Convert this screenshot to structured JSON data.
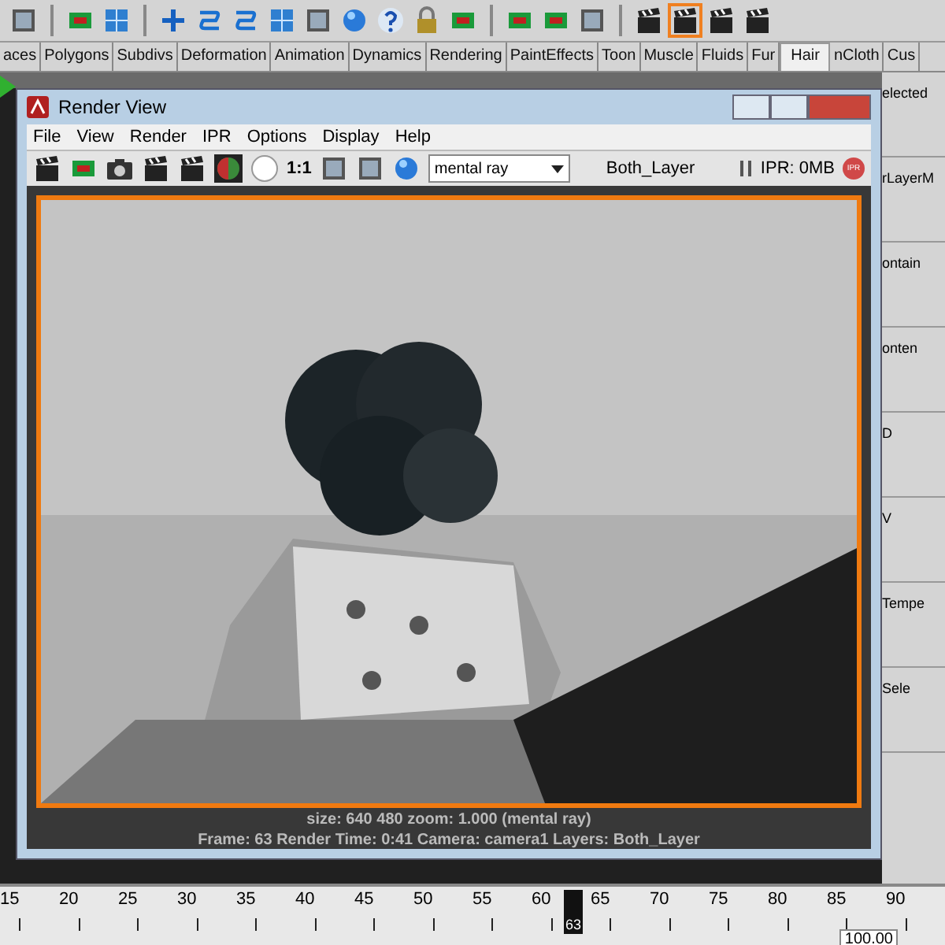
{
  "shelf": {
    "tabs": [
      {
        "label": "aces",
        "selected": false
      },
      {
        "label": "Polygons",
        "selected": false
      },
      {
        "label": "Subdivs",
        "selected": false
      },
      {
        "label": "Deformation",
        "selected": false
      },
      {
        "label": "Animation",
        "selected": false
      },
      {
        "label": "Dynamics",
        "selected": false
      },
      {
        "label": "Rendering",
        "selected": false
      },
      {
        "label": "PaintEffects",
        "selected": false
      },
      {
        "label": "Toon",
        "selected": false
      },
      {
        "label": "Muscle",
        "selected": false
      },
      {
        "label": "Fluids",
        "selected": false
      },
      {
        "label": "Fur",
        "selected": false
      },
      {
        "label": "Hair",
        "selected": true
      },
      {
        "label": "nCloth",
        "selected": false
      },
      {
        "label": "Cus",
        "selected": false
      }
    ]
  },
  "render_view": {
    "title": "Render View",
    "menus": [
      "File",
      "View",
      "Render",
      "IPR",
      "Options",
      "Display",
      "Help"
    ],
    "zoom_button": "1:1",
    "renderer": "mental ray",
    "layer": "Both_Layer",
    "ipr_memory": "IPR: 0MB",
    "ipr_badge": "IPR",
    "status_lines": [
      "size: 640 480 zoom: 1.000   (mental ray)",
      "Frame: 63     Render Time: 0:41     Camera: camera1     Layers: Both_Layer"
    ]
  },
  "side_panel": {
    "labels": [
      "elected",
      "rLayerM",
      "ontain",
      "onten",
      "D",
      "V",
      "Tempe",
      "Sele"
    ]
  },
  "time_slider": {
    "ticks": [
      "15",
      "20",
      "25",
      "30",
      "35",
      "40",
      "45",
      "50",
      "55",
      "60",
      "65",
      "70",
      "75",
      "80",
      "85",
      "90"
    ],
    "current_frame": "63",
    "range_end": "100.00"
  }
}
